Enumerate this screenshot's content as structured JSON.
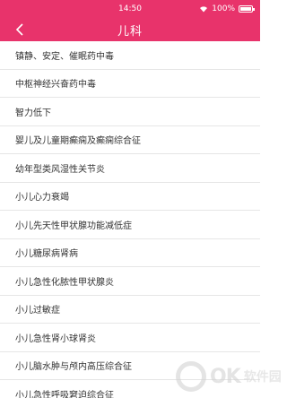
{
  "status_bar": {
    "time": "14:50",
    "battery": "100%"
  },
  "nav": {
    "title": "儿科",
    "back_icon": "chevron-left-icon"
  },
  "list": {
    "items": [
      "镇静、安定、催眠药中毒",
      "中枢神经兴奋药中毒",
      "智力低下",
      "婴儿及儿童期癫痫及癫痫综合征",
      "幼年型类风湿性关节炎",
      "小儿心力衰竭",
      "小儿先天性甲状腺功能减低症",
      "小儿糖尿病肾病",
      "小儿急性化脓性甲状腺炎",
      "小儿过敏症",
      "小儿急性肾小球肾炎",
      "小儿脑水肿与颅内高压综合征",
      "小儿急性呼吸窘迫综合征"
    ]
  },
  "watermark": {
    "logo_text": "OK",
    "site_text": "软件园"
  },
  "colors": {
    "accent": "#e8336b",
    "divider": "#e6e6e6",
    "text": "#333333"
  }
}
